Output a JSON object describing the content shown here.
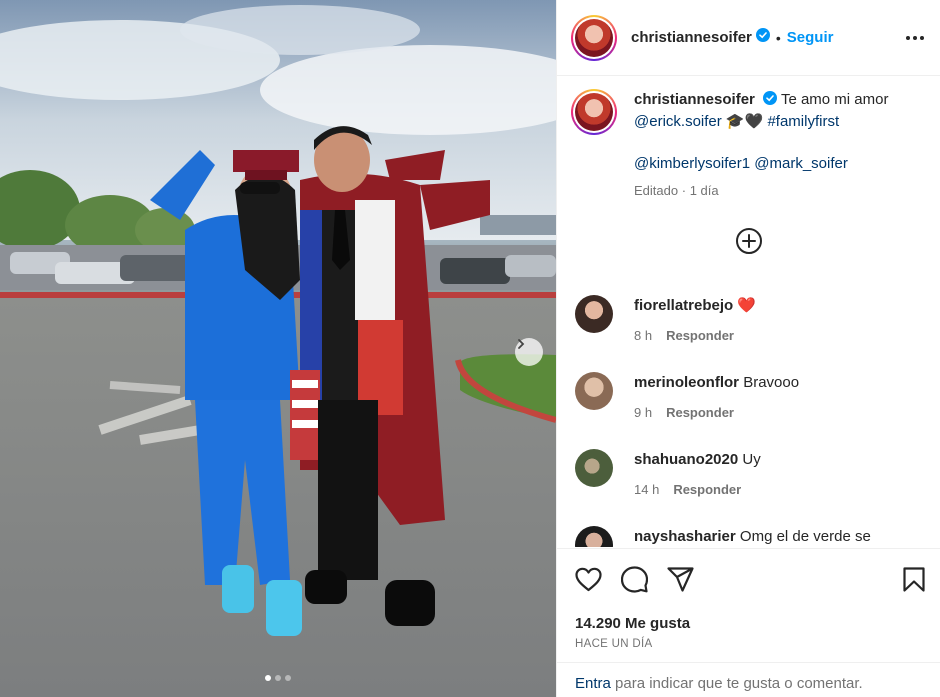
{
  "post": {
    "username": "christiannesoifer",
    "follow_label": "Seguir",
    "separator": "•",
    "caption_text": "Te amo mi amor",
    "caption_mention_1": "@erick.soifer",
    "caption_emoji": "🎓🖤",
    "caption_hashtag": "#familyfirst",
    "caption_mention_2": "@kimberlysoifer1",
    "caption_mention_3": "@mark_soifer",
    "edited_label": "Editado",
    "edited_dot": "·",
    "edited_time": "1 día"
  },
  "comments": [
    {
      "username": "fiorellatrebejo",
      "text": "❤️",
      "time": "8 h",
      "reply_label": "Responder"
    },
    {
      "username": "merinoleonflor",
      "text": "Bravooo",
      "time": "9 h",
      "reply_label": "Responder"
    },
    {
      "username": "shahuano2020",
      "text": "Uy",
      "time": "14 h",
      "reply_label": "Responder"
    },
    {
      "username": "nayshasharier",
      "text": "Omg el de verde se",
      "time": "",
      "reply_label": ""
    }
  ],
  "stats": {
    "likes": "14.290 Me gusta",
    "posted_ago": "HACE UN DÍA"
  },
  "footer": {
    "enter_label": "Entra",
    "rest_label": "para indicar que te gusta o comentar."
  },
  "carousel": {
    "total": 3,
    "active": 1
  },
  "colors": {
    "accent": "#0095f6",
    "mention": "#00376b",
    "muted": "#737373",
    "heart": "#ed4956"
  }
}
